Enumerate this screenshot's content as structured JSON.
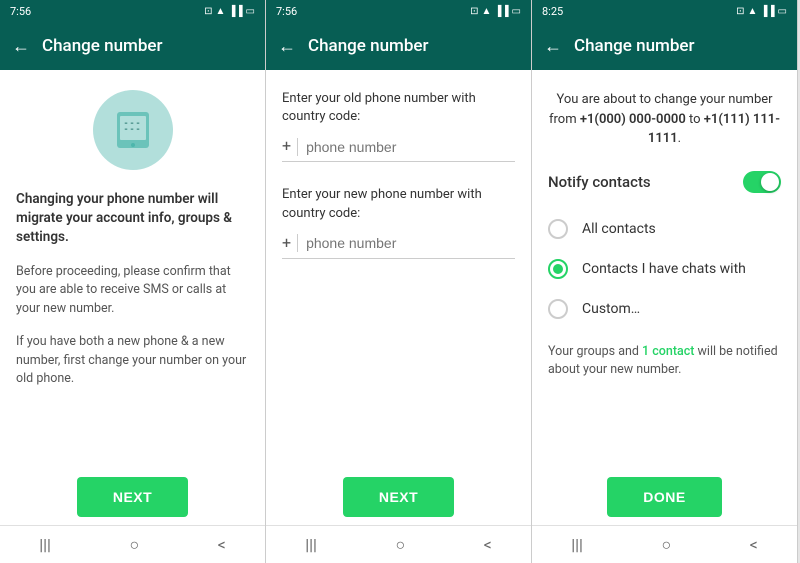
{
  "screen1": {
    "status_time": "7:56",
    "header_title": "Change number",
    "back_arrow": "←",
    "main_text": "Changing your phone number will migrate your account info, groups & settings.",
    "sub_text1": "Before proceeding, please confirm that you are able to receive SMS or calls at your new number.",
    "sub_text2": "If you have both a new phone & a new number, first change your number on your old phone.",
    "next_button": "NEXT"
  },
  "screen2": {
    "status_time": "7:56",
    "header_title": "Change number",
    "back_arrow": "←",
    "old_label": "Enter your old phone number with country code:",
    "old_placeholder": "phone number",
    "new_label": "Enter your new phone number with country code:",
    "new_placeholder": "phone number",
    "next_button": "NEXT"
  },
  "screen3": {
    "status_time": "8:25",
    "header_title": "Change number",
    "back_arrow": "←",
    "change_info_prefix": "You are about to change your number from ",
    "old_number": "+1(000) 000-0000",
    "change_info_mid": " to ",
    "new_number": "+1(111) 111-1111",
    "change_info_suffix": ".",
    "notify_label": "Notify contacts",
    "radio_all": "All contacts",
    "radio_chats": "Contacts I have chats with",
    "radio_custom": "Custom…",
    "groups_note_prefix": "Your groups and ",
    "contact_link": "1 contact",
    "groups_note_suffix": " will be notified about your new number.",
    "done_button": "DONE"
  },
  "nav": {
    "menu_icon": "|||",
    "home_icon": "○",
    "back_icon": "<"
  }
}
